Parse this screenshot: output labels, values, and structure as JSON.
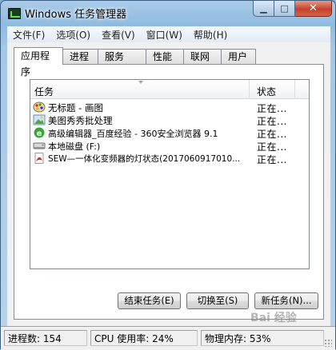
{
  "window": {
    "title": "Windows 任务管理器"
  },
  "menu": {
    "items": [
      "文件(F)",
      "选项(O)",
      "查看(V)",
      "窗口(W)",
      "帮助(H)"
    ]
  },
  "tabs": [
    "应用程序",
    "进程",
    "服务",
    "性能",
    "联网",
    "用户"
  ],
  "tasks": {
    "columns": {
      "task": "任务",
      "status": "状态"
    },
    "rows": [
      {
        "name": "无标题 - 画图",
        "status": "正在...",
        "icon": "paint-icon"
      },
      {
        "name": "美图秀秀批处理",
        "status": "正在...",
        "icon": "image-icon"
      },
      {
        "name": "高级编辑器_百度经验 - 360安全浏览器 9.1",
        "status": "正在...",
        "icon": "browser-icon"
      },
      {
        "name": "本地磁盘 (F:)",
        "status": "正在...",
        "icon": "disk-icon"
      },
      {
        "name": "SEW—一体化变频器的灯状态(2017060917010...",
        "status": "正在...",
        "icon": "pdf-icon"
      }
    ]
  },
  "buttons": {
    "end_task": "结束任务(E)",
    "switch_to": "切换至(S)",
    "new_task": "新任务(N)..."
  },
  "statusbar": {
    "processes": "进程数: 154",
    "cpu": "CPU 使用率: 24%",
    "memory": "物理内存: 53%"
  },
  "watermark": "Bai 经验"
}
